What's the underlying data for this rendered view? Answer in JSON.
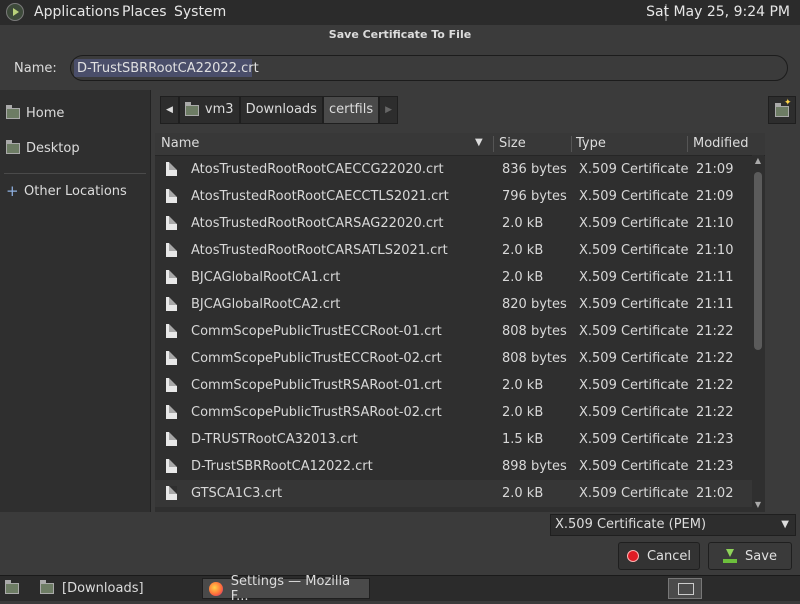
{
  "top_panel": {
    "menus": [
      "Applications",
      "Places",
      "System"
    ],
    "clock": "Sat May 25,  9:24 PM"
  },
  "dialog": {
    "title": "Save Certificate To File",
    "name_label": "Name:",
    "name_value": "D-TrustSBRRootCA22022.crt"
  },
  "sidebar": {
    "items": [
      {
        "label": "Home",
        "icon": "home-folder-icon"
      },
      {
        "label": "Desktop",
        "icon": "desktop-folder-icon"
      },
      {
        "label": "Other Locations",
        "icon": "plus-icon"
      }
    ]
  },
  "path_bar": {
    "crumbs": [
      "vm3",
      "Downloads",
      "certfils"
    ]
  },
  "file_list": {
    "columns": [
      "Name",
      "Size",
      "Type",
      "Modified"
    ],
    "rows": [
      {
        "name": "AtosTrustedRootRootCAECCG22020.crt",
        "size": "836 bytes",
        "type": "X.509 Certificate",
        "modified": "21:09"
      },
      {
        "name": "AtosTrustedRootRootCAECCTLS2021.crt",
        "size": "796 bytes",
        "type": "X.509 Certificate",
        "modified": "21:09"
      },
      {
        "name": "AtosTrustedRootRootCARSAG22020.crt",
        "size": "2.0 kB",
        "type": "X.509 Certificate",
        "modified": "21:10"
      },
      {
        "name": "AtosTrustedRootRootCARSATLS2021.crt",
        "size": "2.0 kB",
        "type": "X.509 Certificate",
        "modified": "21:10"
      },
      {
        "name": "BJCAGlobalRootCA1.crt",
        "size": "2.0 kB",
        "type": "X.509 Certificate",
        "modified": "21:11"
      },
      {
        "name": "BJCAGlobalRootCA2.crt",
        "size": "820 bytes",
        "type": "X.509 Certificate",
        "modified": "21:11"
      },
      {
        "name": "CommScopePublicTrustECCRoot-01.crt",
        "size": "808 bytes",
        "type": "X.509 Certificate",
        "modified": "21:22"
      },
      {
        "name": "CommScopePublicTrustECCRoot-02.crt",
        "size": "808 bytes",
        "type": "X.509 Certificate",
        "modified": "21:22"
      },
      {
        "name": "CommScopePublicTrustRSARoot-01.crt",
        "size": "2.0 kB",
        "type": "X.509 Certificate",
        "modified": "21:22"
      },
      {
        "name": "CommScopePublicTrustRSARoot-02.crt",
        "size": "2.0 kB",
        "type": "X.509 Certificate",
        "modified": "21:22"
      },
      {
        "name": "D-TRUSTRootCA32013.crt",
        "size": "1.5 kB",
        "type": "X.509 Certificate",
        "modified": "21:23"
      },
      {
        "name": "D-TrustSBRRootCA12022.crt",
        "size": "898 bytes",
        "type": "X.509 Certificate",
        "modified": "21:23"
      },
      {
        "name": "GTSCA1C3.crt",
        "size": "2.0 kB",
        "type": "X.509 Certificate",
        "modified": "21:02"
      }
    ]
  },
  "filter": {
    "selected": "X.509 Certificate (PEM)"
  },
  "buttons": {
    "cancel": "Cancel",
    "save": "Save"
  },
  "taskbar": {
    "tasks": [
      "[Downloads]",
      "Settings — Mozilla F..."
    ]
  },
  "colors": {
    "background": "#3b3b3b",
    "panel": "#2b2b2b",
    "selection": "#4a4e6a",
    "cancel_icon": "#e01b24",
    "save_icon": "#6cbf3c"
  }
}
